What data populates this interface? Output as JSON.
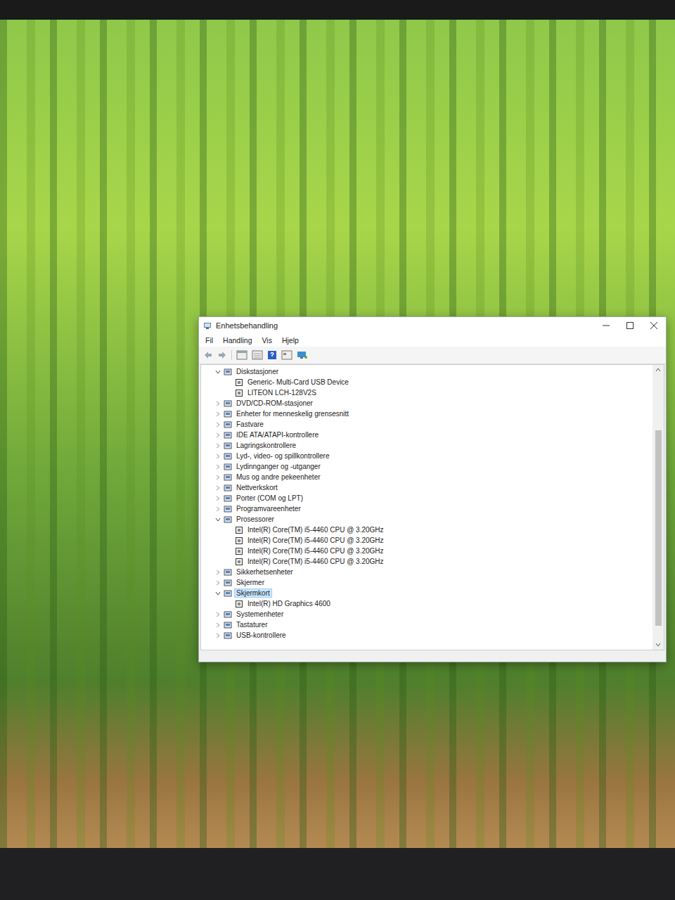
{
  "window": {
    "title": "Enhetsbehandling"
  },
  "menu": [
    "Fil",
    "Handling",
    "Vis",
    "Hjelp"
  ],
  "tree": [
    {
      "label": "Diskstasjoner",
      "expanded": true,
      "selected": false,
      "children": [
        {
          "label": "Generic- Multi-Card USB Device",
          "selected": false
        },
        {
          "label": "LITEON LCH-128V2S",
          "selected": false
        }
      ]
    },
    {
      "label": "DVD/CD-ROM-stasjoner",
      "expanded": false,
      "selected": false,
      "children": []
    },
    {
      "label": "Enheter for menneskelig grensesnitt",
      "expanded": false,
      "selected": false,
      "children": []
    },
    {
      "label": "Fastvare",
      "expanded": false,
      "selected": false,
      "children": []
    },
    {
      "label": "IDE ATA/ATAPI-kontrollere",
      "expanded": false,
      "selected": false,
      "children": []
    },
    {
      "label": "Lagringskontrollere",
      "expanded": false,
      "selected": false,
      "children": []
    },
    {
      "label": "Lyd-, video- og spillkontrollere",
      "expanded": false,
      "selected": false,
      "children": []
    },
    {
      "label": "Lydinnganger og -utganger",
      "expanded": false,
      "selected": false,
      "children": []
    },
    {
      "label": "Mus og andre pekeenheter",
      "expanded": false,
      "selected": false,
      "children": []
    },
    {
      "label": "Nettverkskort",
      "expanded": false,
      "selected": false,
      "children": []
    },
    {
      "label": "Porter (COM og LPT)",
      "expanded": false,
      "selected": false,
      "children": []
    },
    {
      "label": "Programvareenheter",
      "expanded": false,
      "selected": false,
      "children": []
    },
    {
      "label": "Prosessorer",
      "expanded": true,
      "selected": false,
      "children": [
        {
          "label": "Intel(R) Core(TM) i5-4460  CPU @ 3.20GHz",
          "selected": false
        },
        {
          "label": "Intel(R) Core(TM) i5-4460  CPU @ 3.20GHz",
          "selected": false
        },
        {
          "label": "Intel(R) Core(TM) i5-4460  CPU @ 3.20GHz",
          "selected": false
        },
        {
          "label": "Intel(R) Core(TM) i5-4460  CPU @ 3.20GHz",
          "selected": false
        }
      ]
    },
    {
      "label": "Sikkerhetsenheter",
      "expanded": false,
      "selected": false,
      "children": []
    },
    {
      "label": "Skjermer",
      "expanded": false,
      "selected": false,
      "children": []
    },
    {
      "label": "Skjermkort",
      "expanded": true,
      "selected": true,
      "children": [
        {
          "label": "Intel(R) HD Graphics 4600",
          "selected": false
        }
      ]
    },
    {
      "label": "Systemenheter",
      "expanded": false,
      "selected": false,
      "children": []
    },
    {
      "label": "Tastaturer",
      "expanded": false,
      "selected": false,
      "children": []
    },
    {
      "label": "USB-kontrollere",
      "expanded": false,
      "selected": false,
      "children": []
    }
  ],
  "scrollbar": {
    "level": 0.78
  }
}
